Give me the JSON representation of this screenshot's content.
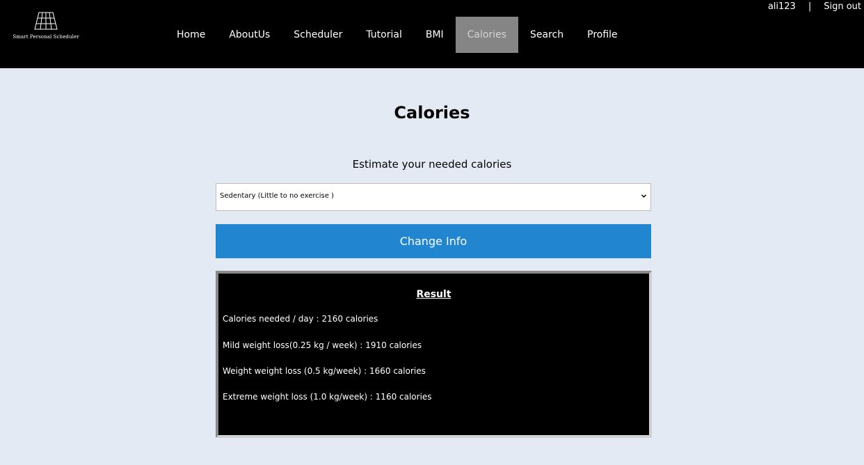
{
  "header": {
    "logo_text": "Smart Personal Scheduler",
    "nav": [
      {
        "label": "Home"
      },
      {
        "label": "AboutUs"
      },
      {
        "label": "Scheduler"
      },
      {
        "label": "Tutorial"
      },
      {
        "label": "BMI"
      },
      {
        "label": "Calories",
        "active": true
      },
      {
        "label": "Search"
      },
      {
        "label": "Profile"
      }
    ],
    "username": "ali123",
    "separator": "|",
    "sign_out": "Sign out"
  },
  "main": {
    "title": "Calories",
    "subtitle": "Estimate your needed calories",
    "activity_select": {
      "value": "Sedentary (Little to no exercise )"
    },
    "change_button": "Change Info",
    "result": {
      "title": "Result",
      "lines": [
        "Calories needed / day :   2160 calories",
        "Mild weight loss(0.25 kg / week) : 1910 calories",
        "Weight weight loss (0.5 kg/week) : 1660 calories",
        "Extreme weight loss (1.0 kg/week) : 1160 calories"
      ]
    }
  },
  "colors": {
    "header_bg": "#000000",
    "page_bg": "#e4eaf4",
    "active_nav": "#858585",
    "button": "#2185cf",
    "result_bg": "#000000"
  }
}
